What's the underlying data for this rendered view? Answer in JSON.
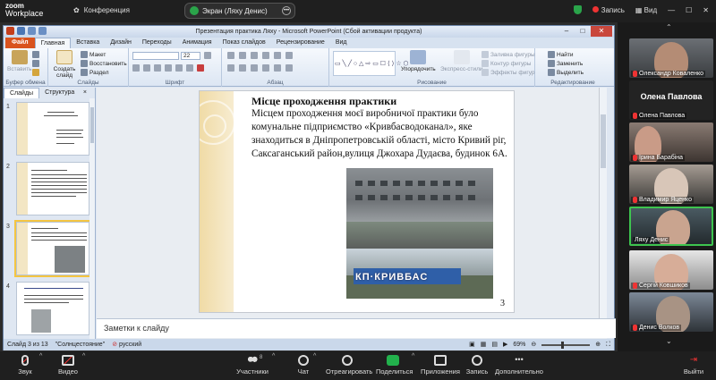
{
  "zoom": {
    "logo_line1": "zoom",
    "logo_line2": "Workplace",
    "conference_label": "Конференция",
    "screen_pill_label": "Экран (Ляху Денис)",
    "record_label": "Запись",
    "view_label": "Вид",
    "toolbar": {
      "audio": "Звук",
      "video": "Видео",
      "participants": "Участники",
      "participants_count": "8",
      "chat": "Чат",
      "react": "Отреагировать",
      "share": "Поделиться",
      "apps": "Приложения",
      "record": "Запись",
      "more": "Дополнительно",
      "leave": "Выйти"
    }
  },
  "ppt": {
    "window_title": "Презентация практика Ляху - Microsoft PowerPoint (Сбой активации продукта)",
    "tabs": [
      "Файл",
      "Главная",
      "Вставка",
      "Дизайн",
      "Переходы",
      "Анимация",
      "Показ слайдов",
      "Рецензирование",
      "Вид"
    ],
    "ribbon": {
      "paste": "Вставить",
      "clipboard": "Буфер обмена",
      "create_slide": "Создать слайд",
      "layout": "Макет",
      "reset": "Восстановить",
      "section": "Раздел",
      "slides_group": "Слайды",
      "font_size": "22",
      "font_group": "Шрифт",
      "paragraph_group": "Абзац",
      "arrange": "Упорядочить",
      "quick_styles": "Экспресс-стили",
      "shape_fill": "Заливка фигуры",
      "shape_outline": "Контур фигуры",
      "shape_effects": "Эффекты фигур",
      "drawing_group": "Рисование",
      "find": "Найти",
      "replace": "Заменить",
      "select": "Выделить",
      "editing_group": "Редактирование"
    },
    "left_tabs": [
      "Слайды",
      "Структура"
    ],
    "left_close": "×",
    "thumb_numbers": [
      "1",
      "2",
      "3",
      "4"
    ],
    "slide": {
      "title": "Місце проходження практики",
      "body": "Місцем проходження моєї виробничої практики було комунальне підприємство «Кривбасводоканал», яке знаходиться в Дніпропетровській області, місто Кривий ріг, Саксаганський район,вулиця Джохара Дудаєва, будинок 6А.",
      "photo_sign": "КП·КРИВБАС",
      "page_number": "3"
    },
    "notes_placeholder": "Заметки к слайду",
    "status": {
      "slide_info": "Слайд 3 из 13",
      "theme": "\"Солнцестояние\"",
      "language": "русский",
      "zoom": "69%"
    }
  },
  "participants": [
    {
      "name": "Олександр Коваленко",
      "type": "video"
    },
    {
      "name": "Олена Павлова",
      "big": "Олена Павлова",
      "type": "text"
    },
    {
      "name": "Ірина Барабіна",
      "type": "video"
    },
    {
      "name": "Владимир Яценко",
      "type": "video"
    },
    {
      "name": "Ляху Денис",
      "type": "video",
      "active": true
    },
    {
      "name": "Сергій Ковшиков",
      "type": "video"
    },
    {
      "name": "Денис Волков",
      "type": "video"
    }
  ],
  "colors": {
    "zoom_green": "#22b14c",
    "ppt_file_tab": "#d9531e",
    "active_speaker": "#3ec44f",
    "slide_band": "#f0dba6"
  }
}
